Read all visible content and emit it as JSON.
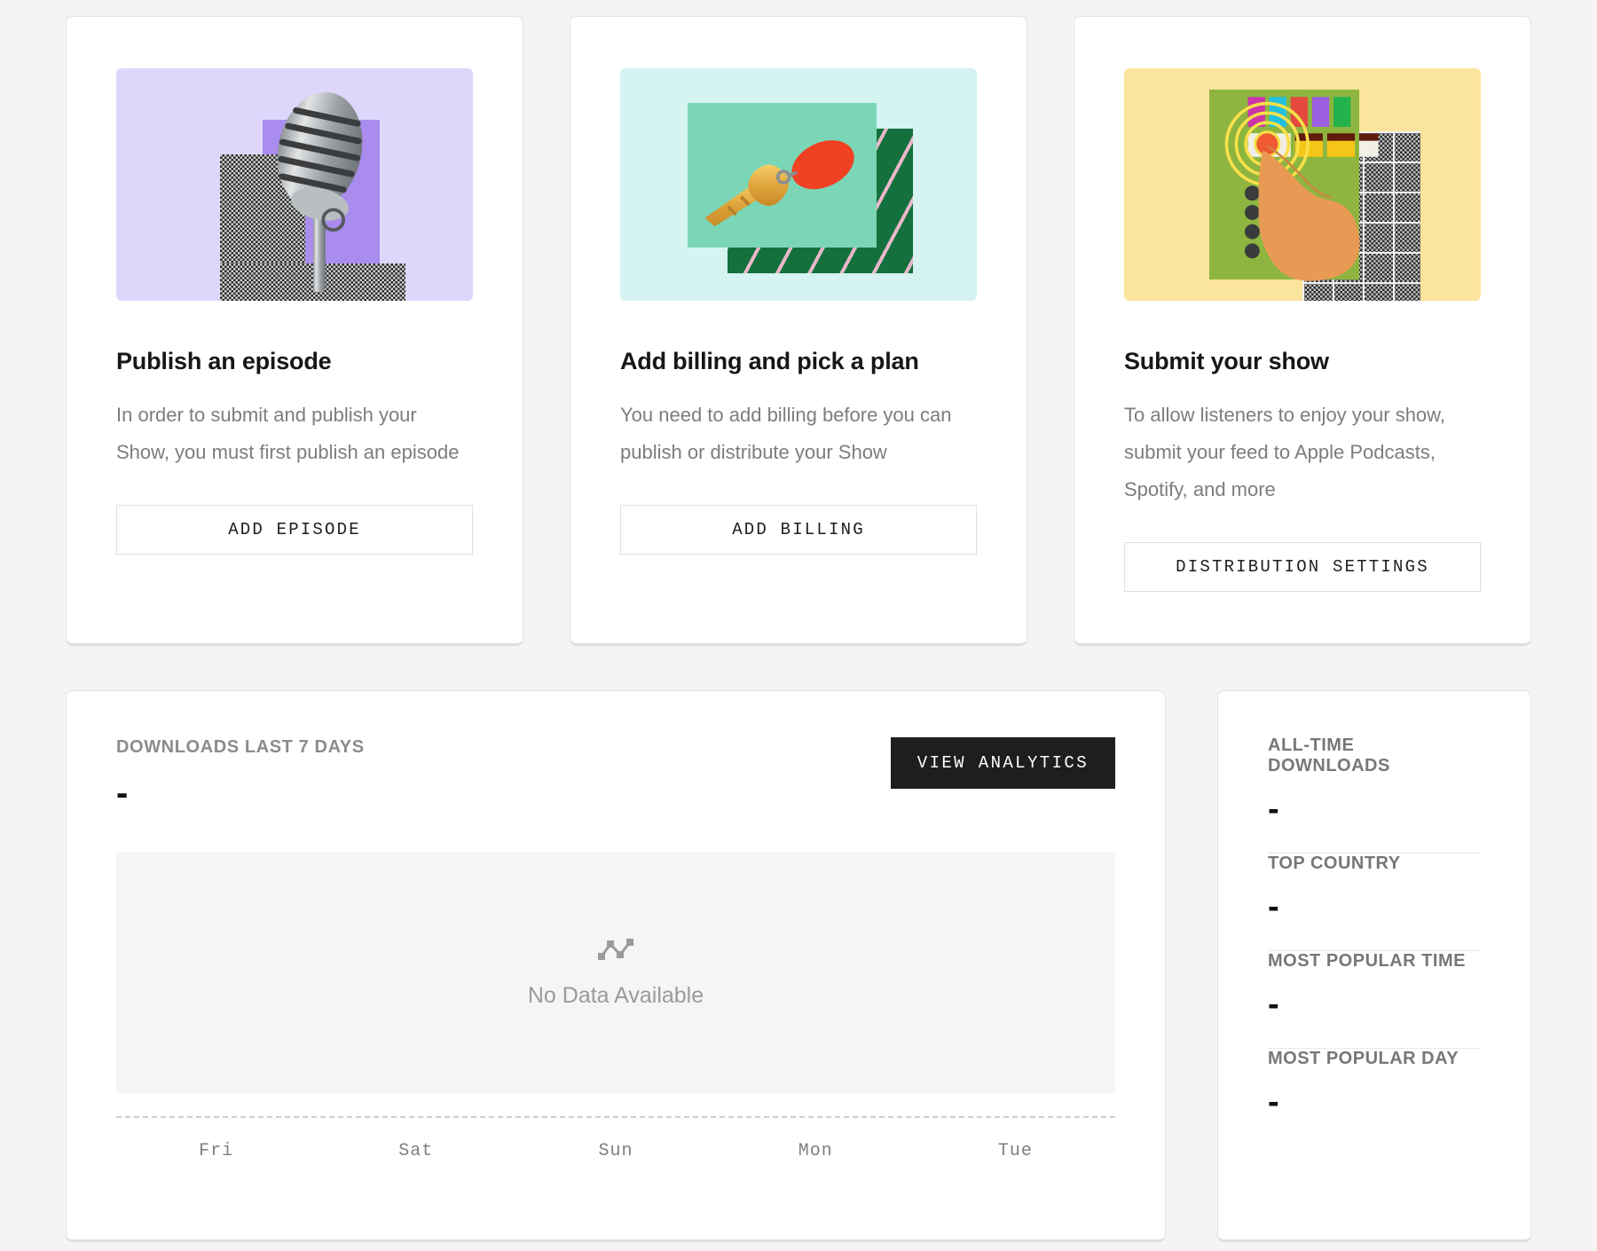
{
  "onboarding_cards": [
    {
      "illustration": "microphone-illustration",
      "title": "Publish an episode",
      "body": "In order to submit and publish your Show, you must first publish an episode",
      "button": "ADD EPISODE",
      "accent": "#ded7fb"
    },
    {
      "illustration": "key-illustration",
      "title": "Add billing and pick a plan",
      "body": "You need to add billing before you can publish or distribute your Show",
      "button": "ADD BILLING",
      "accent": "#d4f3f1"
    },
    {
      "illustration": "finger-mixer-illustration",
      "title": "Submit your show",
      "body": "To allow listeners to enjoy your show, submit your feed to Apple Podcasts, Spotify, and more",
      "button": "DISTRIBUTION SETTINGS",
      "accent": "#fbe49b"
    }
  ],
  "analytics": {
    "label": "DOWNLOADS LAST 7 DAYS",
    "value": "-",
    "view_button": "VIEW ANALYTICS",
    "empty_text": "No Data Available",
    "empty_icon": "line-chart-icon"
  },
  "chart_data": {
    "type": "line",
    "title": "DOWNLOADS LAST 7 DAYS",
    "categories": [
      "Fri",
      "Sat",
      "Sun",
      "Mon",
      "Tue"
    ],
    "values": [
      null,
      null,
      null,
      null,
      null
    ],
    "series": [
      {
        "name": "Downloads",
        "values": [
          null,
          null,
          null,
          null,
          null
        ]
      }
    ],
    "xlabel": "",
    "ylabel": "",
    "ylim": [
      0,
      0
    ],
    "grid": false,
    "legend": "none",
    "empty_state": "No Data Available",
    "total_label": "DOWNLOADS LAST 7 DAYS",
    "total_value": "-"
  },
  "stats": [
    {
      "label": "ALL-TIME DOWNLOADS",
      "value": "-"
    },
    {
      "label": "TOP COUNTRY",
      "value": "-"
    },
    {
      "label": "MOST POPULAR TIME",
      "value": "-"
    },
    {
      "label": "MOST POPULAR DAY",
      "value": "-"
    }
  ],
  "colors": {
    "page_background": "#f5f4f2",
    "card_background": "#ffffff",
    "dark_button": "#1e1e1c",
    "muted_text": "#7d7d80"
  }
}
